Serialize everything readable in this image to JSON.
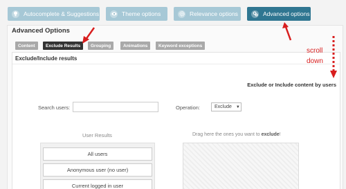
{
  "top_tabs": [
    {
      "label": "Autocomplete & Suggestions",
      "icon": "lightbulb-icon",
      "active": false
    },
    {
      "label": "Theme options",
      "icon": "eye-icon",
      "active": false
    },
    {
      "label": "Relevance options",
      "icon": "settings-icon",
      "active": false
    },
    {
      "label": "Advanced options",
      "icon": "gears-icon",
      "active": true
    }
  ],
  "panel": {
    "title": "Advanced Options",
    "sub_tabs": [
      {
        "label": "Content",
        "active": false
      },
      {
        "label": "Exclude Results",
        "active": true
      },
      {
        "label": "Grouping",
        "active": false
      },
      {
        "label": "Animations",
        "active": false
      },
      {
        "label": "Keyword exceptions",
        "active": false
      }
    ],
    "section_title": "Exclude/Include results",
    "sub_heading": "Exclude or Include content by users",
    "search": {
      "label": "Search users:",
      "value": "",
      "placeholder": ""
    },
    "operation": {
      "label": "Operation:",
      "selected": "Exclude"
    },
    "user_results": {
      "heading": "User Results",
      "items": [
        "All users",
        "Anonymous user (no user)",
        "Current logged in user"
      ]
    },
    "drop_zone": {
      "text_before": "Drag here the ones you want to ",
      "text_bold": "exclude",
      "text_after": "!"
    }
  },
  "annotation": {
    "line1": "scroll",
    "line2": "down",
    "color": "#d81e1e"
  },
  "colors": {
    "tab_light": "#a6c8d6",
    "tab_dark": "#2f7691",
    "subtab_active": "#333333",
    "subtab_inactive": "#a9a9a9"
  }
}
